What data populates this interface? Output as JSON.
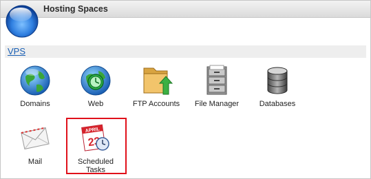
{
  "header": {
    "title": "Hosting Spaces"
  },
  "section": {
    "link_label": "VPS"
  },
  "tiles": [
    {
      "label": "Domains",
      "icon": "globe-icon"
    },
    {
      "label": "Web",
      "icon": "web-globe-icon"
    },
    {
      "label": "FTP Accounts",
      "icon": "ftp-folder-icon"
    },
    {
      "label": "File Manager",
      "icon": "file-cabinet-icon"
    },
    {
      "label": "Databases",
      "icon": "database-icon"
    },
    {
      "label": "Mail",
      "icon": "envelope-icon"
    },
    {
      "label": "Scheduled Tasks",
      "icon": "calendar-clock-icon"
    }
  ],
  "calendar_icon_text": {
    "month": "APRIL",
    "day": "23"
  },
  "colors": {
    "link": "#1a5fb4",
    "highlight": "#e0101a",
    "accent_orb": "#2f7fe0"
  }
}
